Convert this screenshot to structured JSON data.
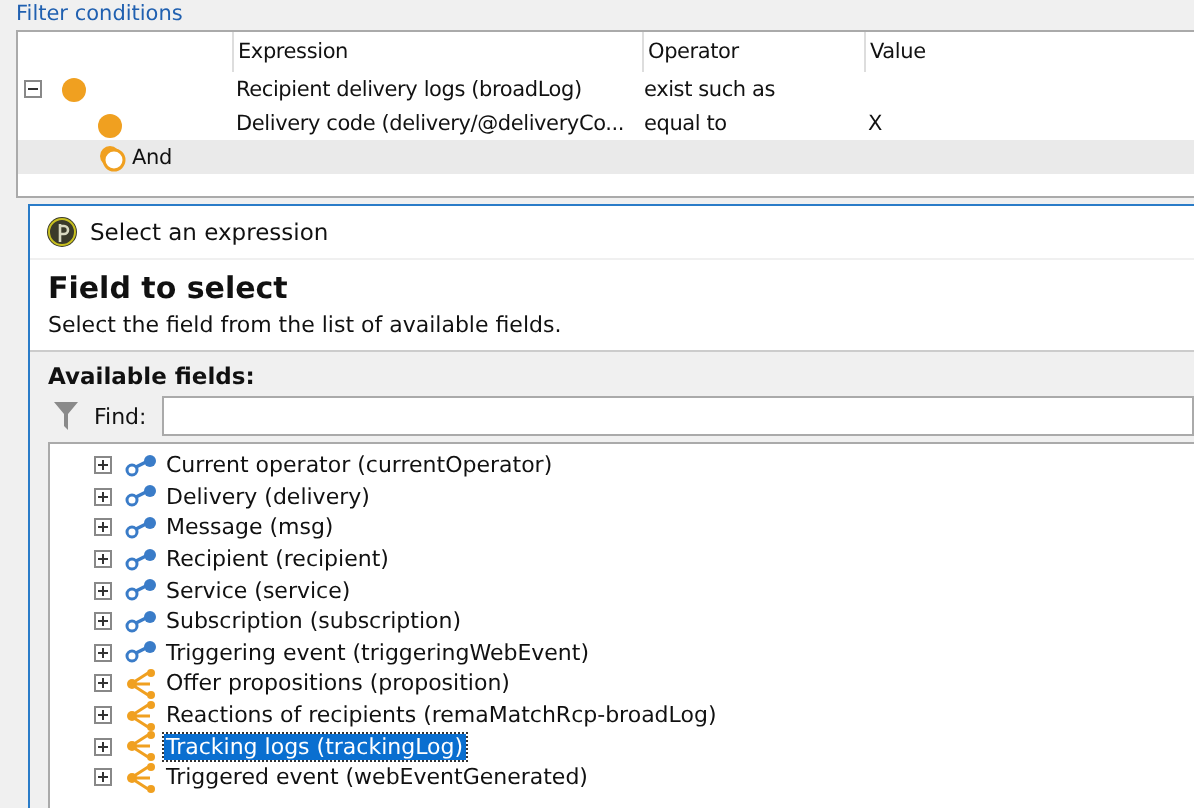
{
  "section_title": "Filter conditions",
  "filter": {
    "columns": [
      "Expression",
      "Operator",
      "Value"
    ],
    "rows": [
      {
        "kind": "condition",
        "expression": "Recipient delivery logs (broadLog)",
        "operator": "exist such as",
        "expanded": true,
        "children": [
          {
            "kind": "condition",
            "expression": "Delivery code (delivery/@deliveryCo...",
            "operator": "equal to",
            "value": "X"
          },
          {
            "kind": "operator",
            "expression": "And"
          }
        ]
      }
    ]
  },
  "dialog": {
    "title": "Select an expression",
    "heading": "Field to select",
    "subtitle": "Select the field from the list of available fields.",
    "fields_label": "Available fields:",
    "find_label": "Find:",
    "items": [
      {
        "label": "Current operator (currentOperator)",
        "kind": "link",
        "selected": false
      },
      {
        "label": "Delivery (delivery)",
        "kind": "link",
        "selected": false
      },
      {
        "label": "Message (msg)",
        "kind": "link",
        "selected": false
      },
      {
        "label": "Recipient (recipient)",
        "kind": "link",
        "selected": false
      },
      {
        "label": "Service (service)",
        "kind": "link",
        "selected": false
      },
      {
        "label": "Subscription (subscription)",
        "kind": "link",
        "selected": false
      },
      {
        "label": "Triggering event (triggeringWebEvent)",
        "kind": "link",
        "selected": false
      },
      {
        "label": "Offer propositions (proposition)",
        "kind": "collection",
        "selected": false
      },
      {
        "label": "Reactions of recipients (remaMatchRcp-broadLog)",
        "kind": "collection",
        "selected": false
      },
      {
        "label": "Tracking logs (trackingLog)",
        "kind": "collection",
        "selected": true
      },
      {
        "label": "Triggered event (webEventGenerated)",
        "kind": "collection",
        "selected": false
      }
    ]
  }
}
